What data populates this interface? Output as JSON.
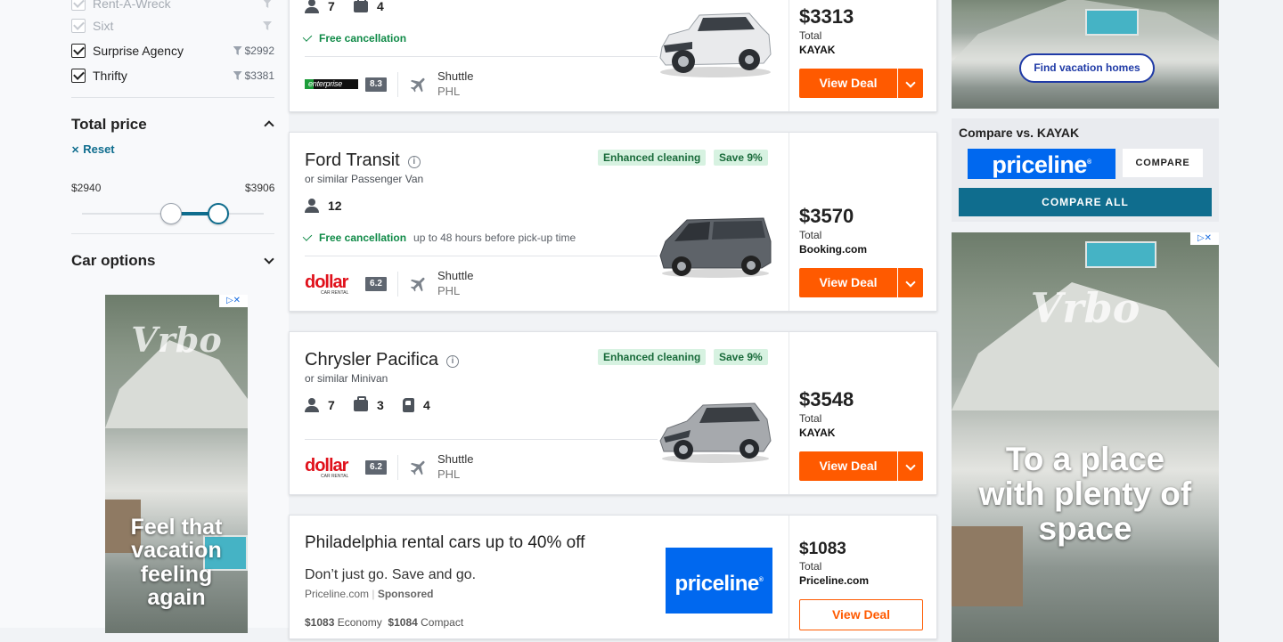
{
  "sidebar": {
    "agencies": [
      {
        "name": "Rent-A-Wreck",
        "price": "",
        "checked": true,
        "faded": true
      },
      {
        "name": "Sixt",
        "price": "",
        "checked": true,
        "faded": true
      },
      {
        "name": "Surprise Agency",
        "price": "$2992",
        "checked": true,
        "faded": false
      },
      {
        "name": "Thrifty",
        "price": "$3381",
        "checked": true,
        "faded": false
      }
    ],
    "total_price": {
      "title": "Total price",
      "reset": "Reset",
      "min_label": "$2940",
      "max_label": "$3906",
      "slider_low_fraction": 0.49,
      "slider_high_fraction": 0.75
    },
    "car_options_title": "Car options",
    "ad": {
      "brand": "Vrbo",
      "headline": "Feel that vacation feeling again"
    }
  },
  "results": [
    {
      "features": {
        "passengers": "7",
        "bags": "4"
      },
      "free_cancellation": "Free cancellation",
      "agency_logo": "enterprise",
      "score": "8.3",
      "pickup_type": "Shuttle",
      "pickup_location": "PHL",
      "price": "$3313",
      "total_label": "Total",
      "provider": "KAYAK",
      "deal_label": "View Deal"
    },
    {
      "title": "Ford Transit",
      "subtitle": "or similar Passenger Van",
      "badges": [
        "Enhanced cleaning",
        "Save 9%"
      ],
      "features": {
        "passengers": "12"
      },
      "free_cancellation": "Free cancellation",
      "free_cancellation_extra": "up to 48 hours before pick-up time",
      "agency_logo": "dollar",
      "agency_logo_sub": "CAR RENTAL",
      "score": "6.2",
      "pickup_type": "Shuttle",
      "pickup_location": "PHL",
      "price": "$3570",
      "total_label": "Total",
      "provider": "Booking.com",
      "deal_label": "View Deal"
    },
    {
      "title": "Chrysler Pacifica",
      "subtitle": "or similar Minivan",
      "badges": [
        "Enhanced cleaning",
        "Save 9%"
      ],
      "features": {
        "passengers": "7",
        "bags": "3",
        "doors": "4"
      },
      "agency_logo": "dollar",
      "agency_logo_sub": "CAR RENTAL",
      "score": "6.2",
      "pickup_type": "Shuttle",
      "pickup_location": "PHL",
      "price": "$3548",
      "total_label": "Total",
      "provider": "KAYAK",
      "deal_label": "View Deal"
    }
  ],
  "sponsored": {
    "title": "Philadelphia rental cars up to 40% off",
    "tagline": "Don’t just go. Save and go.",
    "source": "Priceline.com",
    "sponsored_label": "Sponsored",
    "logo_text": "priceline",
    "economy_price": "$1083",
    "economy_label": "Economy",
    "compact_price": "$1084",
    "compact_label": "Compact",
    "price": "$1083",
    "total_label": "Total",
    "provider": "Priceline.com",
    "deal_label": "View Deal"
  },
  "right_rail": {
    "top_ad_button": "Find vacation homes",
    "compare": {
      "title": "Compare vs. KAYAK",
      "logo_text": "priceline",
      "compare_label": "COMPARE",
      "compare_all_label": "COMPARE ALL"
    },
    "bottom_ad": {
      "brand": "Vrbo",
      "headline": "To a place with plenty of space"
    }
  },
  "colors": {
    "accent_orange": "#ff5a00",
    "success_green": "#0f8a47",
    "slider_blue": "#0f6d8e",
    "priceline_blue": "#0068ef"
  }
}
